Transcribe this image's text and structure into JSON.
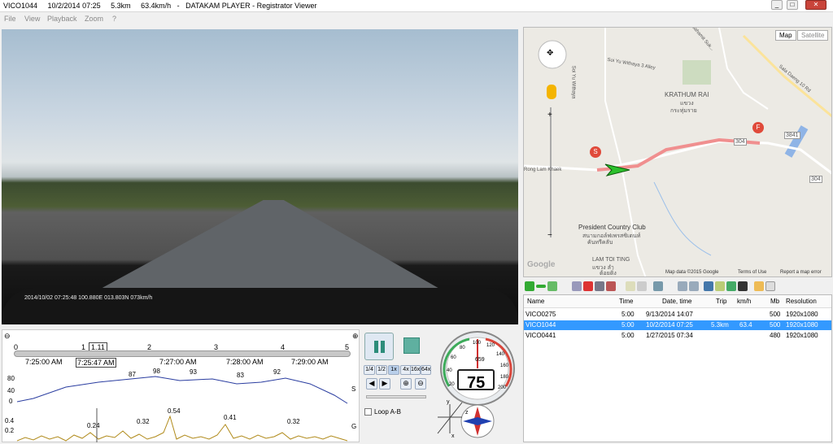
{
  "window": {
    "title": "VICO1044     10/2/2014 07:25     5.3km     63.4km/h   -   DATAKAM PLAYER - Registrator Viewer",
    "close_icon": "close-icon",
    "maximize_icon": "maximize-icon",
    "minimize_icon": "minimize-icon"
  },
  "menu": [
    "File",
    "View",
    "Playback",
    "Zoom",
    "?"
  ],
  "video": {
    "overlay": "2014/10/02 07:25:48 100.880E 013.803N 073km/h"
  },
  "timeline": {
    "scale_labels": [
      "0",
      "1",
      "1.11",
      "2",
      "3",
      "4",
      "5"
    ],
    "time_labels": [
      "7:25:00 AM",
      "7:25:47 AM",
      "7:27:00 AM",
      "7:28:00 AM",
      "7:29:00 AM"
    ],
    "speed_chart": {
      "y_ticks": [
        "80",
        "40",
        "0"
      ],
      "unit": "S",
      "labels": [
        "87",
        "98",
        "93",
        "83",
        "92"
      ]
    },
    "g_chart": {
      "y_ticks": [
        "0.4",
        "0.2"
      ],
      "unit": "G",
      "labels": [
        "0.24",
        "0.32",
        "0.54",
        "0.41",
        "0.32"
      ]
    }
  },
  "controls": {
    "play_pause_icon": "pause-icon",
    "stop_icon": "stop-icon",
    "speed_buttons": [
      "1/4",
      "1/2",
      "1x",
      "4x",
      "16x",
      "64x"
    ],
    "loop_label": "Loop A-B"
  },
  "gauge": {
    "speed": "75",
    "odometer": "659",
    "scale": [
      "20",
      "40",
      "60",
      "80",
      "100",
      "120",
      "140",
      "160",
      "180",
      "200"
    ],
    "axes": [
      "y",
      "z",
      "x"
    ]
  },
  "map": {
    "tabs": [
      "Map",
      "Satellite"
    ],
    "labels": {
      "krathum_rai": "KRATHUM RAI",
      "thai1": "แขวง",
      "thai2": "กระทุ่มราย",
      "president": "President Country Club",
      "president_thai1": "สนามกอล์ฟเพรสซิเดนท์",
      "president_thai2": "คันทรีคลับ",
      "lam_toi_ting": "LAM TOI TING",
      "lam_thai": "แขวง ลำ",
      "lam_thai2": "ต้อยติ่ง",
      "withaya": "Soi Yu Withaya 3 Alley",
      "soi_witthaya": "Soi Yu Withaya",
      "lam_khaek": "Rong Lam Khaek",
      "sala": "Sala Daeng 10 Rd",
      "sahamit": "Sahamit Suk...",
      "road_304": "304",
      "road_3841": "3841",
      "road_3842": "304"
    },
    "marker_start": "S",
    "marker_finish": "F",
    "footer": [
      "Map data ©2015 Google",
      "Terms of Use",
      "Report a map error"
    ],
    "google": "Google",
    "zoom_in": "+",
    "zoom_out": "−"
  },
  "filelist": {
    "columns": [
      "Name",
      "Time",
      "Date, time",
      "Trip",
      "km/h",
      "Mb",
      "Resolution"
    ],
    "rows": [
      {
        "name": "VICO0275",
        "time": "5:00",
        "date": "9/13/2014 14:07",
        "trip": "",
        "kmh": "",
        "mb": "500",
        "res": "1920x1080"
      },
      {
        "name": "VICO1044",
        "time": "5:00",
        "date": "10/2/2014 07:25",
        "trip": "5.3km",
        "kmh": "63.4",
        "mb": "500",
        "res": "1920x1080"
      },
      {
        "name": "VICO0441",
        "time": "5:00",
        "date": "1/27/2015 07:34",
        "trip": "",
        "kmh": "",
        "mb": "480",
        "res": "1920x1080"
      }
    ]
  },
  "colors": {
    "route": "#f08f8f",
    "selection": "#3399ff",
    "speed_line": "#2a3da0",
    "g_line": "#b08a1a"
  }
}
